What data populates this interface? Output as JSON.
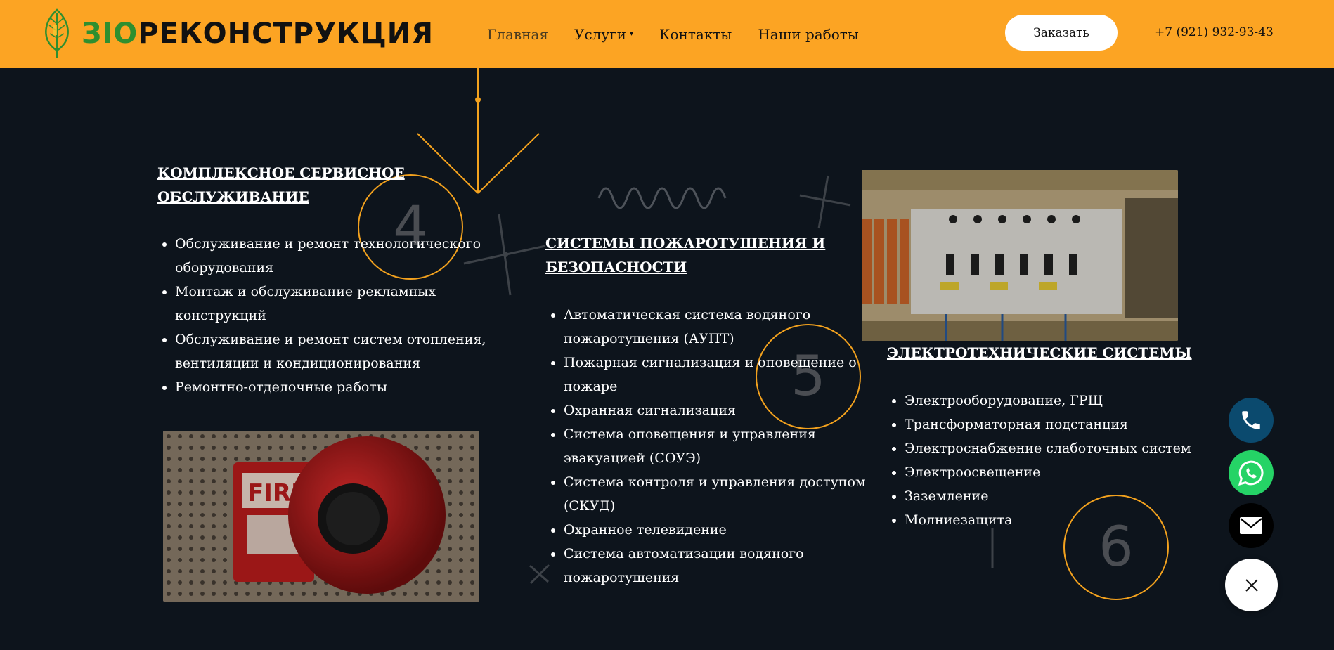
{
  "header": {
    "logo": {
      "part_bio": "ЗIО",
      "part_main": "РЕКОНСТРУКЦИЯ"
    },
    "nav": [
      {
        "label": "Главная"
      },
      {
        "label": "Услуги"
      },
      {
        "label": "Контакты"
      },
      {
        "label": "Наши работы"
      }
    ],
    "order_button": "Заказать",
    "phone": "+7 (921) 932-93-43"
  },
  "sections": [
    {
      "number": "4",
      "title_line1": "КОМПЛЕКСНОЕ СЕРВИСНОЕ",
      "title_line2": "ОБСЛУЖИВАНИЕ",
      "items": [
        "Обслуживание и ремонт технологического оборудования",
        "Монтаж и обслуживание рекламных конструкций",
        "Обслуживание и ремонт систем отопления, вентиляции и кондиционирования",
        "Ремонтно-отделочные работы"
      ],
      "image": "fire-alarm-bell-photo"
    },
    {
      "number": "5",
      "title_line1": "СИСТЕМЫ ПОЖАРОТУШЕНИЯ И",
      "title_line2": "БЕЗОПАСНОСТИ",
      "items": [
        "Автоматическая система водяного пожаротушения (АУПТ)",
        "Пожарная сигнализация и оповещение о пожаре",
        "Охранная сигнализация",
        "Система оповещения и управления эвакуацией (СОУЭ)",
        "Система контроля и управления доступом (СКУД)",
        "Охранное телевидение",
        "Система автоматизации водяного пожаротушения"
      ]
    },
    {
      "number": "6",
      "title_line1": "ЭЛЕКТРОТЕХНИЧЕСКИЕ СИСТЕМЫ",
      "items": [
        "Электрооборудование, ГРЩ",
        "Трансформаторная подстанция",
        "Электроснабжение слаботочных систем",
        "Электроосвещение",
        "Заземление",
        "Молниезащита"
      ],
      "image": "electrical-panel-photo"
    }
  ],
  "widgets": [
    {
      "icon": "phone-icon",
      "color": "#0b4a6e"
    },
    {
      "icon": "whatsapp-icon",
      "color": "#25d366"
    },
    {
      "icon": "mail-icon",
      "color": "#000000"
    },
    {
      "icon": "close-icon",
      "color": "#ffffff"
    }
  ],
  "colors": {
    "accent": "#fca423",
    "background": "#0d141c",
    "circle": "#f3a21e"
  }
}
